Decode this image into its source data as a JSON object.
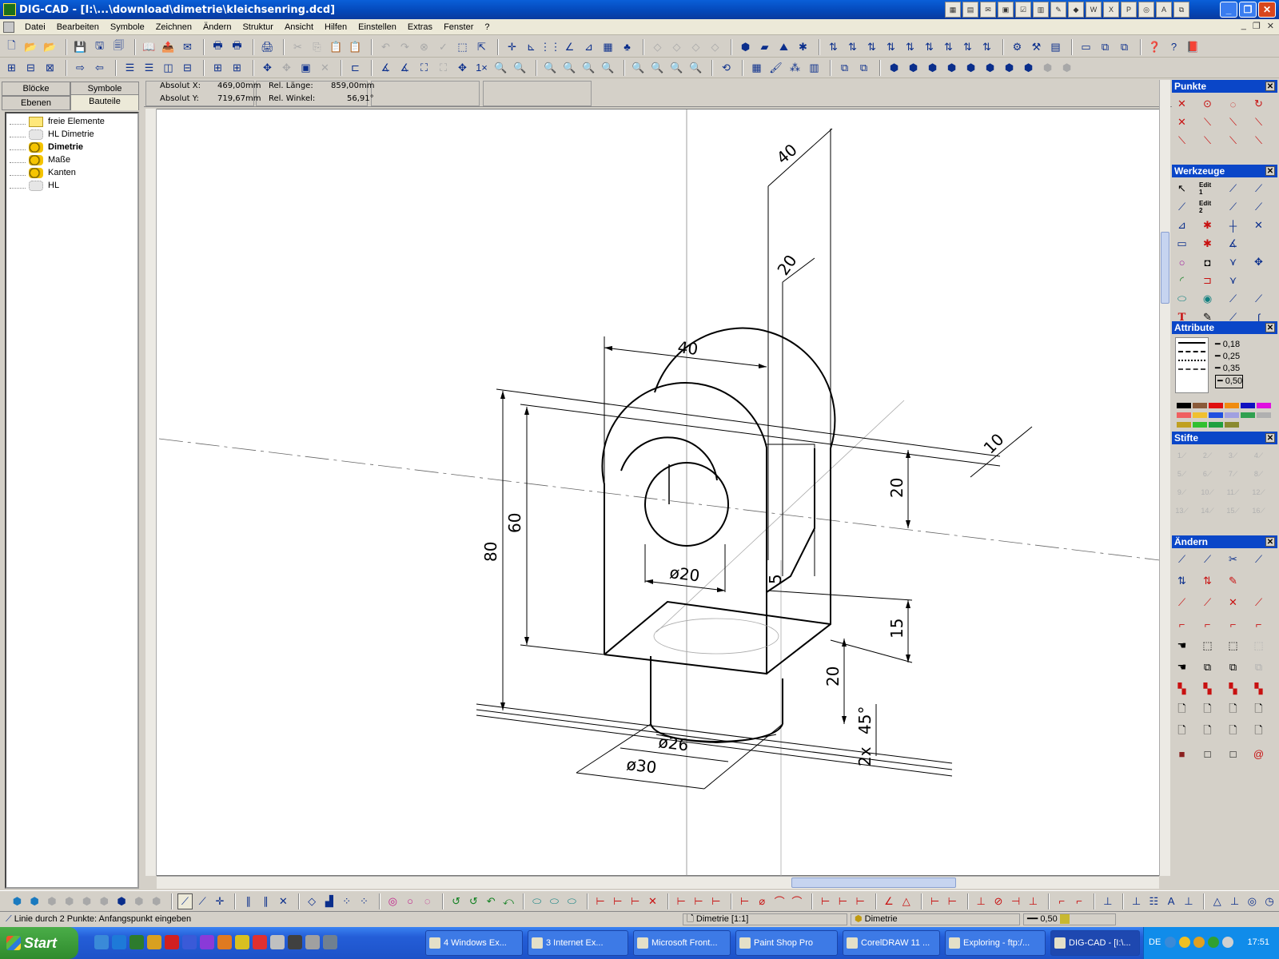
{
  "window": {
    "title": "DIG-CAD - [I:\\...\\download\\dimetrie\\kleichsenring.dcd]"
  },
  "menu": [
    "Datei",
    "Bearbeiten",
    "Symbole",
    "Zeichnen",
    "Ändern",
    "Struktur",
    "Ansicht",
    "Hilfen",
    "Einstellen",
    "Extras",
    "Fenster",
    "?"
  ],
  "left_panel": {
    "tabs": [
      "Blöcke",
      "Symbole",
      "Ebenen",
      "Bauteile"
    ],
    "tree": [
      {
        "label": "freie Elemente",
        "icon": "folder-icon",
        "bold": false
      },
      {
        "label": "HL Dimetrie",
        "icon": "layer-dim-icon",
        "bold": false
      },
      {
        "label": "Dimetrie",
        "icon": "layer-icon",
        "bold": true
      },
      {
        "label": "Maße",
        "icon": "layer-icon",
        "bold": false
      },
      {
        "label": "Kanten",
        "icon": "layer-icon",
        "bold": false
      },
      {
        "label": "HL",
        "icon": "layer-dim-icon",
        "bold": false
      }
    ]
  },
  "coords": {
    "abs_x_label": "Absolut X:",
    "abs_x_value": "469,00mm",
    "abs_y_label": "Absolut Y:",
    "abs_y_value": "719,67mm",
    "rel_len_label": "Rel. Länge:",
    "rel_len_value": "859,00mm",
    "rel_angle_label": "Rel. Winkel:",
    "rel_angle_value": "56,91°"
  },
  "drawing": {
    "dims": {
      "d40_top": "40",
      "d20_top": "20",
      "d40": "40",
      "d10": "10",
      "d20_right": "20",
      "d80": "80",
      "d60": "60",
      "phi20": "ø20",
      "d5": "5",
      "d15": "15",
      "d20_lower": "20",
      "d45": "45°",
      "d2x": "2x",
      "phi26": "ø26",
      "phi30": "ø30"
    }
  },
  "palettes": {
    "punkte": "Punkte",
    "werkzeuge": "Werkzeuge",
    "attribute": "Attribute",
    "stifte": "Stifte",
    "aendern": "Ändern",
    "line_weights": [
      "0,18",
      "0,25",
      "0,35",
      "0,50"
    ],
    "edit1": "Edit 1",
    "edit2": "Edit 2",
    "colors": [
      "#000000",
      "#8a5a3a",
      "#e01010",
      "#f08c10",
      "#1010c0",
      "#e010e0",
      "#f06060",
      "#f0c030",
      "#2050e0",
      "#a0a0e0",
      "#30a050",
      "#b0b0b0",
      "#c0a020",
      "#30c030",
      "#20a040",
      "#8a8a30"
    ],
    "pens": [
      "1",
      "2",
      "3",
      "4",
      "5",
      "6",
      "7",
      "8",
      "9",
      "10",
      "11",
      "12",
      "13",
      "14",
      "15",
      "16"
    ]
  },
  "status": {
    "message": "Linie durch 2 Punkte: Anfangspunkt eingeben",
    "view": "Dimetrie [1:1]",
    "layer": "Dimetrie",
    "line_weight": "0,50"
  },
  "taskbar": {
    "start": "Start",
    "tasks": [
      "4 Windows Ex...",
      "3 Internet Ex...",
      "Microsoft Front...",
      "Paint Shop Pro",
      "CorelDRAW 11 ...",
      "Exploring - ftp:/...",
      "DIG-CAD - [I:\\..."
    ],
    "lang": "DE",
    "clock": "17:51"
  }
}
